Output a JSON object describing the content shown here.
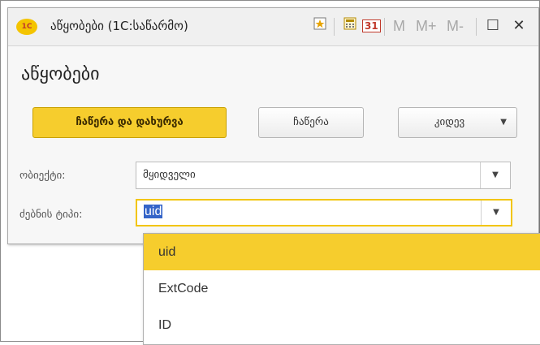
{
  "window": {
    "logo_text": "1С",
    "title": "აწყობები (1С:საწარმო)"
  },
  "toolbar": {
    "icons": [
      "bookmark-star-icon",
      "calculator-icon",
      "calendar-icon"
    ],
    "calendar_text": "31",
    "m_label": "M",
    "m_plus_label": "M+",
    "m_minus_label": "M-",
    "maximize_symbol": "☐",
    "close_symbol": "✕"
  },
  "form": {
    "heading": "აწყობები",
    "buttons": {
      "save_close": "ჩაწერა და დახურვა",
      "save": "ჩაწერა",
      "more": "კიდევ"
    },
    "fields": [
      {
        "label": "ობიექტი:",
        "value": "მყიდველი"
      },
      {
        "label": "ძებნის ტიპი:",
        "value": "uid"
      }
    ]
  },
  "dropdown": {
    "options": [
      "uid",
      "ExtCode",
      "ID"
    ],
    "selected": "uid"
  },
  "colors": {
    "accent": "#f6cd2d",
    "selection": "#3464c8"
  }
}
